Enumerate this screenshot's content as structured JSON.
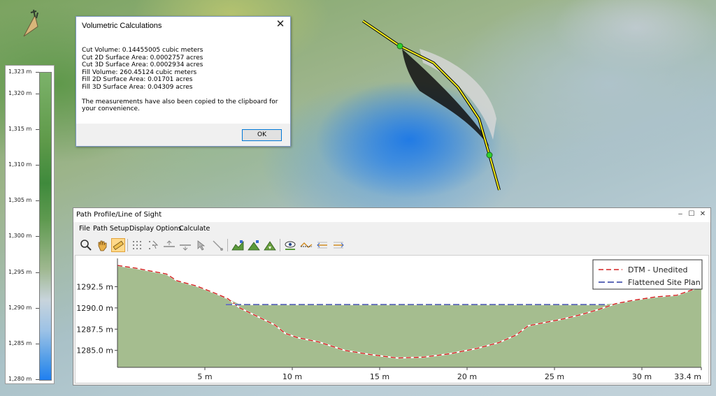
{
  "map": {
    "legend": {
      "ticks": [
        {
          "label": "1,323 m",
          "value": 1323
        },
        {
          "label": "1,320 m",
          "value": 1320
        },
        {
          "label": "1,315 m",
          "value": 1315
        },
        {
          "label": "1,310 m",
          "value": 1310
        },
        {
          "label": "1,305 m",
          "value": 1305
        },
        {
          "label": "1,300 m",
          "value": 1300
        },
        {
          "label": "1,295 m",
          "value": 1295
        },
        {
          "label": "1,290 m",
          "value": 1290
        },
        {
          "label": "1,285 m",
          "value": 1285
        },
        {
          "label": "1,280 m",
          "value": 1280
        }
      ],
      "range": [
        1280,
        1323
      ]
    },
    "compass_icon": "north-arrow-icon",
    "path_color": "#f5ee1a",
    "vertex_color": "#2fd02f"
  },
  "volumetric_dialog": {
    "title": "Volumetric Calculations",
    "lines": [
      "Cut Volume: 0.14455005 cubic meters",
      "Cut 2D Surface Area: 0.0002757 acres",
      "Cut 3D Surface Area: 0.0002934 acres",
      "Fill Volume: 260.45124 cubic meters",
      "Fill 2D Surface Area: 0.01701 acres",
      "Fill 3D Surface Area: 0.04309 acres"
    ],
    "note": "The measurements have also been copied to the clipboard for your convenience.",
    "ok_label": "OK",
    "close_glyph": "✕"
  },
  "profile_window": {
    "title": "Path Profile/Line of Sight",
    "controls": {
      "minimize": "–",
      "maximize": "☐",
      "close": "✕"
    },
    "menu": [
      "File",
      "Path Setup",
      "Display Options",
      "Calculate"
    ],
    "toolbar_icons": [
      "zoom-icon",
      "pan-hand-icon",
      "measure-ruler-icon",
      "grid-points-icon",
      "grid-select-icon",
      "profile-up-icon",
      "profile-down-icon",
      "pointer-icon",
      "line-pointer-icon",
      "terrain-edit-icon",
      "terrain-fill-icon",
      "terrain-cut-icon",
      "line-of-sight-eye-icon",
      "site-plan-icon",
      "flatten-left-icon",
      "flatten-right-icon"
    ]
  },
  "chart_data": {
    "type": "area",
    "x_unit": "m",
    "xlim": [
      0,
      33.4
    ],
    "ylim": [
      1283.0,
      1295.5
    ],
    "x_ticks": [
      5,
      10,
      15,
      20,
      25,
      30
    ],
    "x_tick_labels": [
      "5 m",
      "10 m",
      "15 m",
      "20 m",
      "25 m",
      "30 m"
    ],
    "x_end_label": "33.4 m",
    "y_ticks": [
      1285.0,
      1287.5,
      1290.0,
      1292.5
    ],
    "y_tick_labels": [
      "1285.0 m",
      "1287.5 m",
      "1290.0 m",
      "1292.5 m"
    ],
    "fill_color": "#a5bd8f",
    "legend_position": "top-right",
    "series": [
      {
        "name": "DTM - Unedited",
        "color": "#d42020",
        "x": [
          0,
          1,
          2,
          2.8,
          3.4,
          4.5,
          5.5,
          6.3,
          7,
          8,
          9,
          9.6,
          10.3,
          11.5,
          13,
          14.5,
          16,
          17.5,
          19,
          20.5,
          21.8,
          22.8,
          23.5,
          24.5,
          25.5,
          26.5,
          27.5,
          28.5,
          29.5,
          30.8,
          32,
          33.4
        ],
        "y": [
          1295.0,
          1294.7,
          1294.3,
          1294.0,
          1293.2,
          1292.6,
          1291.8,
          1291.1,
          1290.0,
          1289.0,
          1288.0,
          1287.0,
          1286.5,
          1286.0,
          1285.0,
          1284.5,
          1284.1,
          1284.2,
          1284.6,
          1285.2,
          1285.9,
          1286.8,
          1287.9,
          1288.3,
          1288.7,
          1289.2,
          1289.8,
          1290.5,
          1290.9,
          1291.3,
          1291.5,
          1292.5
        ]
      },
      {
        "name": "Flattened Site Plan",
        "color": "#2a3aa0",
        "x": [
          6.2,
          28.0
        ],
        "y": [
          1290.4,
          1290.4
        ]
      }
    ]
  }
}
